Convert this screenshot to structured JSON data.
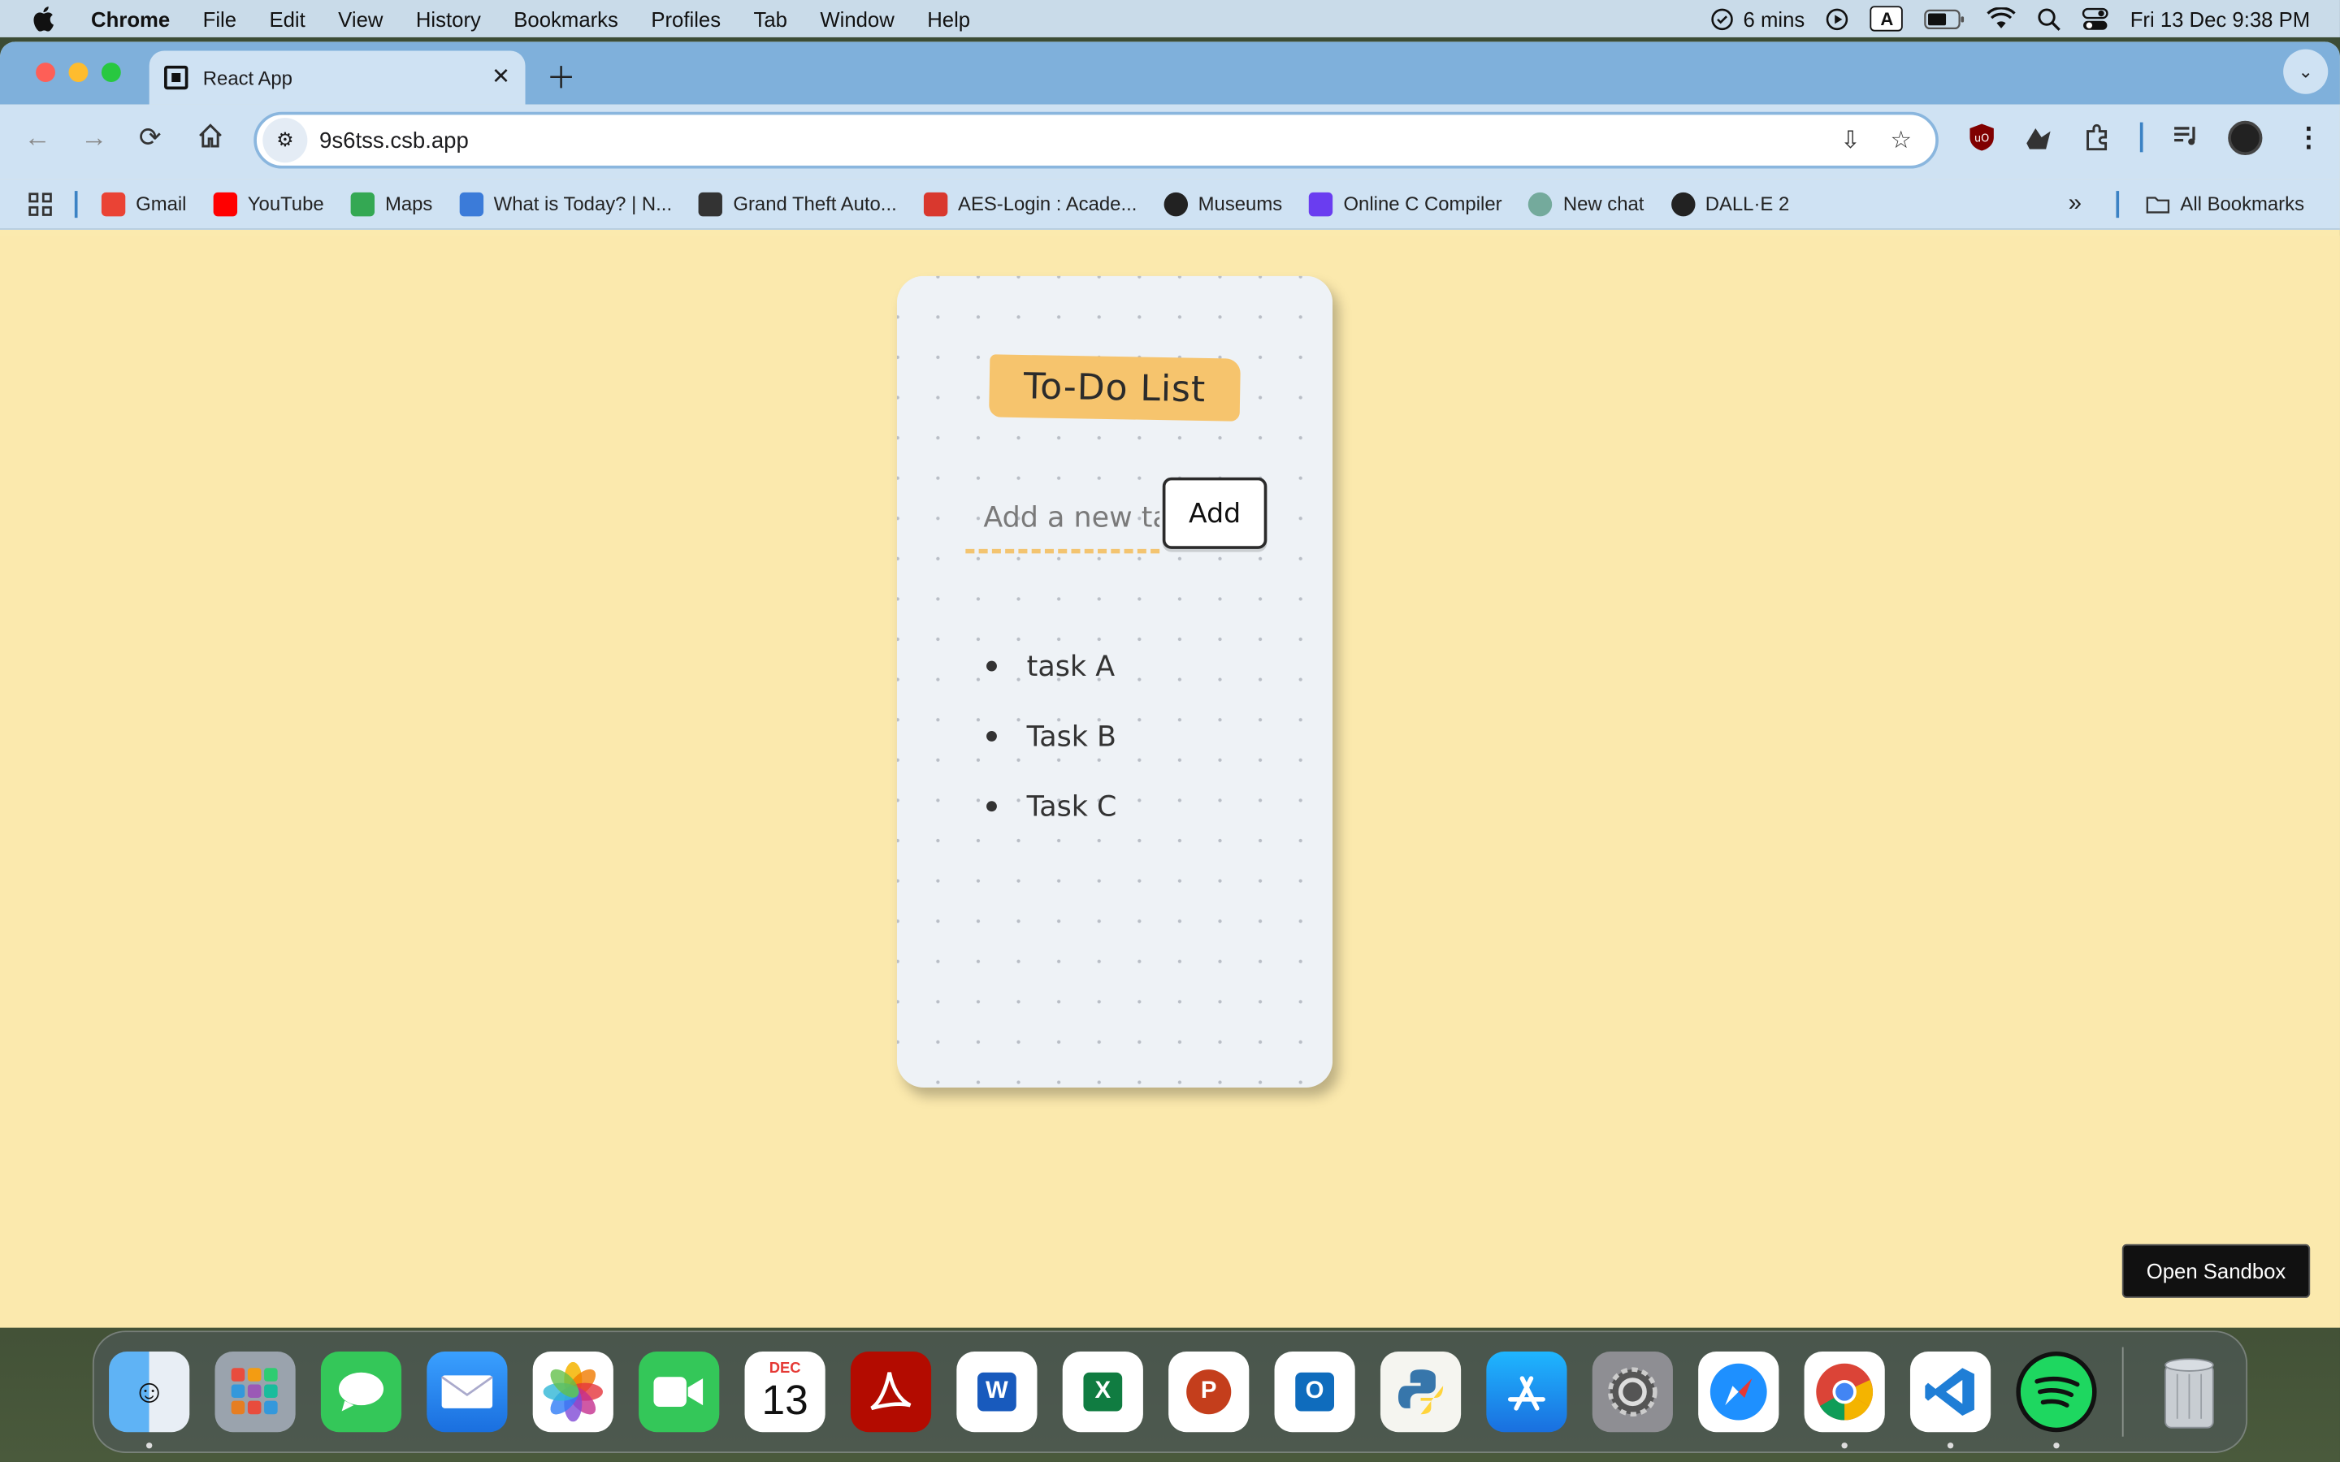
{
  "menubar": {
    "app_name": "Chrome",
    "items": [
      "File",
      "Edit",
      "View",
      "History",
      "Bookmarks",
      "Profiles",
      "Tab",
      "Window",
      "Help"
    ],
    "timer": "6 mins",
    "input_source": "A",
    "datetime": "Fri 13 Dec  9:38 PM"
  },
  "browser": {
    "tab_title": "React App",
    "url": "9s6tss.csb.app",
    "bookmarks": [
      {
        "label": "Gmail",
        "icon": "gmail-icon",
        "color": "#ea4335"
      },
      {
        "label": "YouTube",
        "icon": "youtube-icon",
        "color": "#ff0000"
      },
      {
        "label": "Maps",
        "icon": "maps-icon",
        "color": "#34a853"
      },
      {
        "label": "What is Today? | N...",
        "icon": "nt-icon",
        "color": "#3b7bd9"
      },
      {
        "label": "Grand Theft Auto...",
        "icon": "gta-icon",
        "color": "#333333"
      },
      {
        "label": "AES-Login : Acade...",
        "icon": "aes-icon",
        "color": "#d9382e"
      },
      {
        "label": "Museums",
        "icon": "globe-icon",
        "color": "#222222"
      },
      {
        "label": "Online C Compiler",
        "icon": "compiler-icon",
        "color": "#6a3df0"
      },
      {
        "label": "New chat",
        "icon": "chatgpt-icon",
        "color": "#74aa9c"
      },
      {
        "label": "DALL·E 2",
        "icon": "dalle-icon",
        "color": "#222222"
      }
    ],
    "all_bookmarks": "All Bookmarks"
  },
  "app": {
    "title": "To-Do List",
    "input_placeholder": "Add a new task",
    "add_label": "Add",
    "tasks": [
      "task A",
      "Task B",
      "Task C"
    ],
    "sandbox_label": "Open Sandbox"
  },
  "dock": {
    "calendar_month": "DEC",
    "calendar_day": "13",
    "apps": [
      "Finder",
      "Launchpad",
      "Messages",
      "Mail",
      "Photos",
      "FaceTime",
      "Calendar",
      "Acrobat",
      "Word",
      "Excel",
      "PowerPoint",
      "Outlook",
      "Python",
      "App Store",
      "System Settings",
      "Safari",
      "Chrome",
      "VS Code",
      "Spotify",
      "Trash"
    ]
  }
}
